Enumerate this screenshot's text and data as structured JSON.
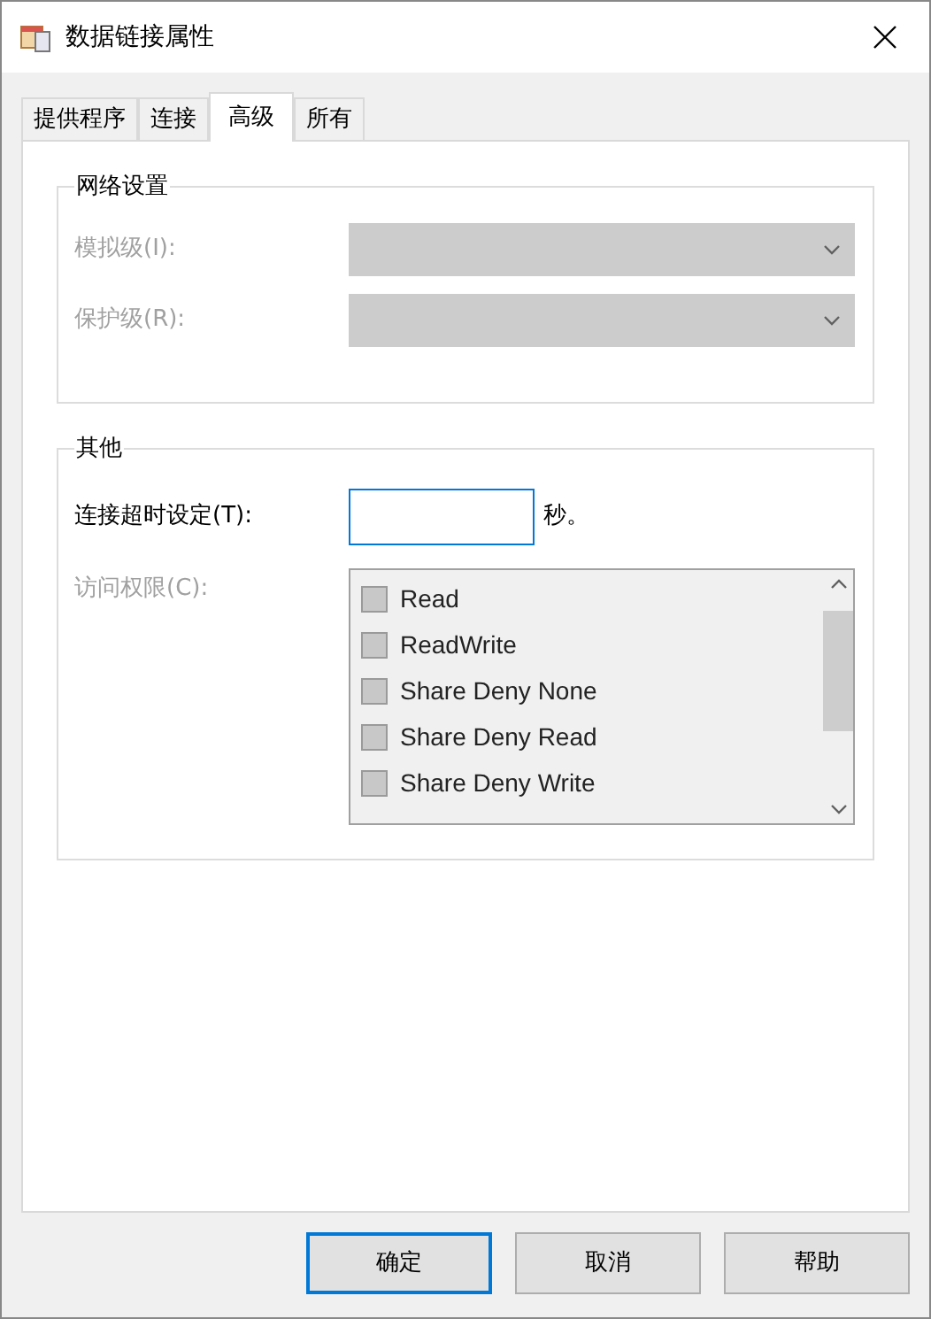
{
  "window": {
    "title": "数据链接属性"
  },
  "tabs": [
    {
      "label": "提供程序",
      "selected": false
    },
    {
      "label": "连接",
      "selected": false
    },
    {
      "label": "高级",
      "selected": true
    },
    {
      "label": "所有",
      "selected": false
    }
  ],
  "network_group": {
    "title": "网络设置",
    "fields": [
      {
        "label": "模拟级(I):",
        "disabled": true
      },
      {
        "label": "保护级(R):",
        "disabled": true
      }
    ]
  },
  "other_group": {
    "title": "其他",
    "timeout": {
      "label": "连接超时设定(T):",
      "unit": "秒。",
      "focused": true
    },
    "access": {
      "label": "访问权限(C):",
      "disabled": true,
      "items": [
        {
          "label": "Read",
          "checked": false
        },
        {
          "label": "ReadWrite",
          "checked": false
        },
        {
          "label": "Share Deny None",
          "checked": false
        },
        {
          "label": "Share Deny Read",
          "checked": false
        },
        {
          "label": "Share Deny Write",
          "checked": false
        }
      ]
    }
  },
  "buttons": [
    {
      "label": "确定",
      "default": true
    },
    {
      "label": "取消",
      "default": false
    },
    {
      "label": "帮助",
      "default": false
    }
  ]
}
